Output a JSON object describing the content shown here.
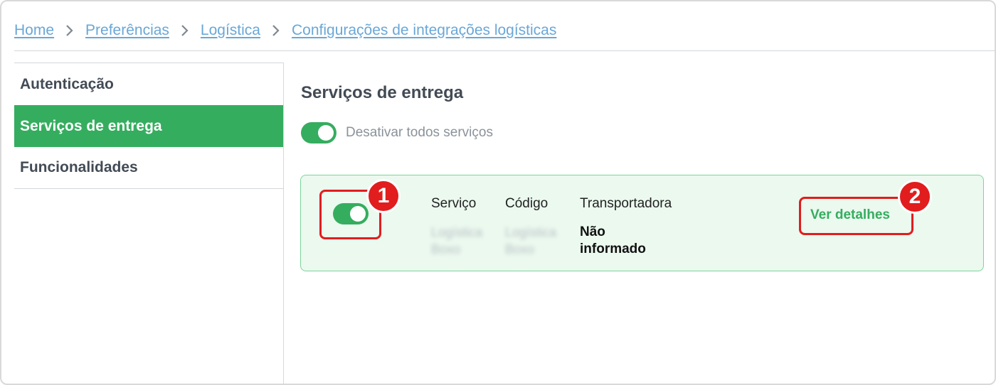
{
  "breadcrumb": {
    "items": [
      {
        "label": "Home"
      },
      {
        "label": "Preferências"
      },
      {
        "label": "Logística"
      },
      {
        "label": "Configurações de integrações logísticas"
      }
    ]
  },
  "sidebar": {
    "items": [
      {
        "label": "Autenticação",
        "active": false
      },
      {
        "label": "Serviços de entrega",
        "active": true
      },
      {
        "label": "Funcionalidades",
        "active": false
      }
    ]
  },
  "main": {
    "title": "Serviços de entrega",
    "toggle_all": {
      "label": "Desativar todos serviços",
      "enabled": true
    },
    "service_card": {
      "enabled": true,
      "columns": {
        "service": "Serviço",
        "code": "Código",
        "carrier": "Transportadora"
      },
      "values": {
        "service": [
          "Logística",
          "Boxo"
        ],
        "code": [
          "Logística",
          "Boxo"
        ],
        "carrier": "Não informado"
      },
      "details_link": "Ver detalhes"
    }
  },
  "annotations": {
    "callout_1": "1",
    "callout_2": "2"
  },
  "colors": {
    "accent": "#35ad5f",
    "link": "#6aa7d6",
    "card_bg": "#ebf9ef",
    "card_border": "#7dd59b",
    "callout": "#e11d1d"
  }
}
